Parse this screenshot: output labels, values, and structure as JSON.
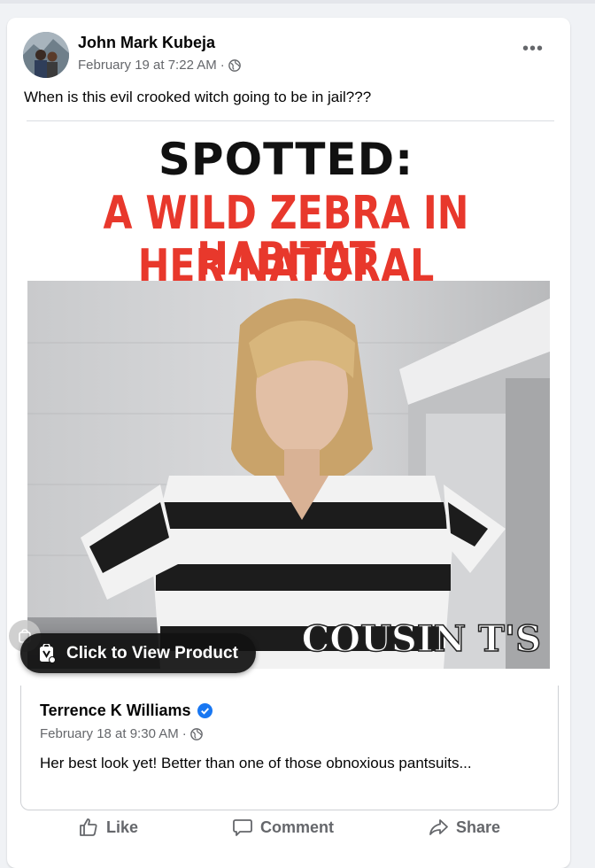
{
  "post": {
    "author": "John Mark Kubeja",
    "timestamp": "February 19 at 7:22 AM",
    "separator": "·",
    "privacy_icon": "globe-icon",
    "more_label": "•••",
    "text": "When is this evil crooked witch going to be in jail???"
  },
  "meme": {
    "line1": "SPOTTED:",
    "line2": "A WILD ZEBRA IN HER NATURAL",
    "line3": "HABITAT",
    "watermark": "COUSIN T'S",
    "headline_color": "#e8382c"
  },
  "product_button": {
    "label": "Click to View Product",
    "icon": "shopping-bag-icon"
  },
  "quoted_post": {
    "author": "Terrence K Williams",
    "verified_icon": "verified-badge-icon",
    "timestamp": "February 18 at 9:30 AM",
    "separator": "·",
    "text": "Her best look yet! Better than one of those obnoxious pantsuits..."
  },
  "actions": {
    "like": "Like",
    "comment": "Comment",
    "share": "Share"
  },
  "colors": {
    "accent_blue": "#1877f2",
    "secondary_text": "#65676b"
  }
}
